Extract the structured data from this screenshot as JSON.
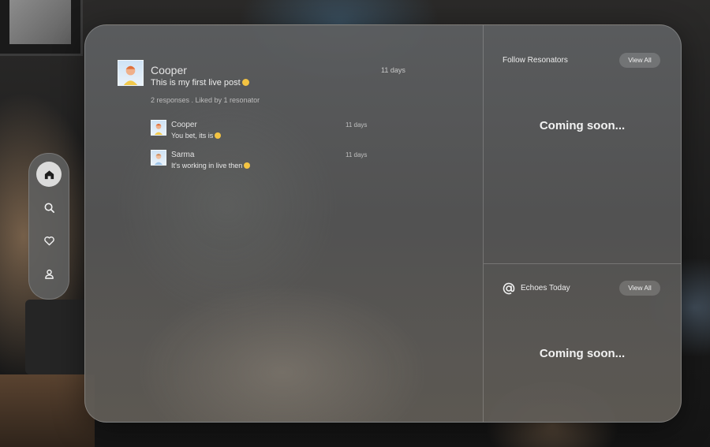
{
  "post": {
    "author": "Cooper",
    "time": "11 days",
    "text": "This is my first live post",
    "emoji": "grinning-emoji",
    "meta": "2 responses . Liked by 1 resonator"
  },
  "replies": [
    {
      "author": "Cooper",
      "time": "11 days",
      "text": "You bet, its is",
      "emoji": "grinning-emoji"
    },
    {
      "author": "Sarma",
      "time": "11 days",
      "text": "It's working in live then",
      "emoji": "winking-emoji"
    }
  ],
  "follow": {
    "title": "Follow Resonators",
    "view_all": "View All",
    "placeholder": "Coming soon..."
  },
  "echoes": {
    "title": "Echoes Today",
    "view_all": "View All",
    "placeholder": "Coming soon...",
    "icon": "at-icon"
  },
  "nav": {
    "items": [
      {
        "name": "home",
        "icon": "home-icon",
        "active": true
      },
      {
        "name": "search",
        "icon": "search-icon",
        "active": false
      },
      {
        "name": "likes",
        "icon": "heart-icon",
        "active": false
      },
      {
        "name": "profile",
        "icon": "user-icon",
        "active": false
      }
    ]
  },
  "colors": {
    "emoji": "#f3c342",
    "panel": "#5a5b5c",
    "text": "#ececec"
  }
}
